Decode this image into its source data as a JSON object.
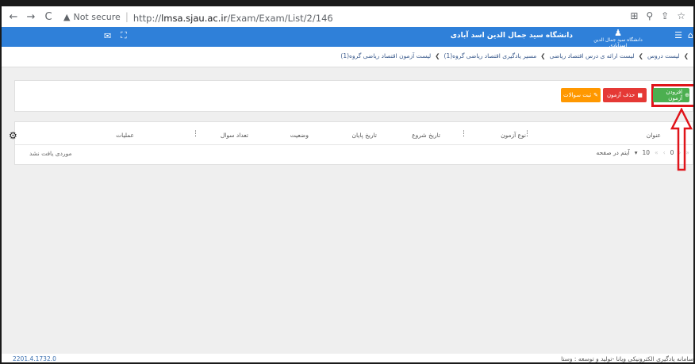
{
  "browser": {
    "back": "←",
    "forward": "→",
    "reload": "C",
    "security_label": "Not secure",
    "url_proto": "http://",
    "url_host": "lmsa.sjau.ac.ir",
    "url_path": "/Exam/Exam/List/2/146"
  },
  "header": {
    "university_name": "دانشگاه سید جمال الدین اسد آبادی",
    "logo_text": "دانشگاه سید جمال الدین اسدآبادی"
  },
  "breadcrumb": [
    "لیست دروس",
    "لیست ارائه ی درس اقتصاد ریاضی",
    "مسیر یادگیری اقتصاد ریاضی گروه(1)",
    "لیست آزمون اقتصاد ریاضی گروه(1)"
  ],
  "toolbar": {
    "add_label": "افزودن آزمون",
    "delete_label": "حذف آزمون",
    "edit_label": "ثبت سوالات"
  },
  "table": {
    "columns": [
      "عنوان",
      "نوع آزمون",
      "تاریخ شروع",
      "تاریخ پایان",
      "وضعیت",
      "تعداد سوال",
      "عملیات"
    ],
    "empty_text": "موردی یافت نشد",
    "page_number": "0",
    "page_size": "10",
    "per_page_label": "آیتم در صفحه"
  },
  "footer": {
    "version": "2201.4.1732.0",
    "credit": "سامانه یادگیری الکترونیکی ویانا -تولید و توسعه : وستا"
  },
  "colors": {
    "appbar": "#2f80d9",
    "add_button": "#4caf50",
    "delete_button": "#e53935",
    "edit_button": "#ff9800",
    "annotation": "#e0141a"
  }
}
